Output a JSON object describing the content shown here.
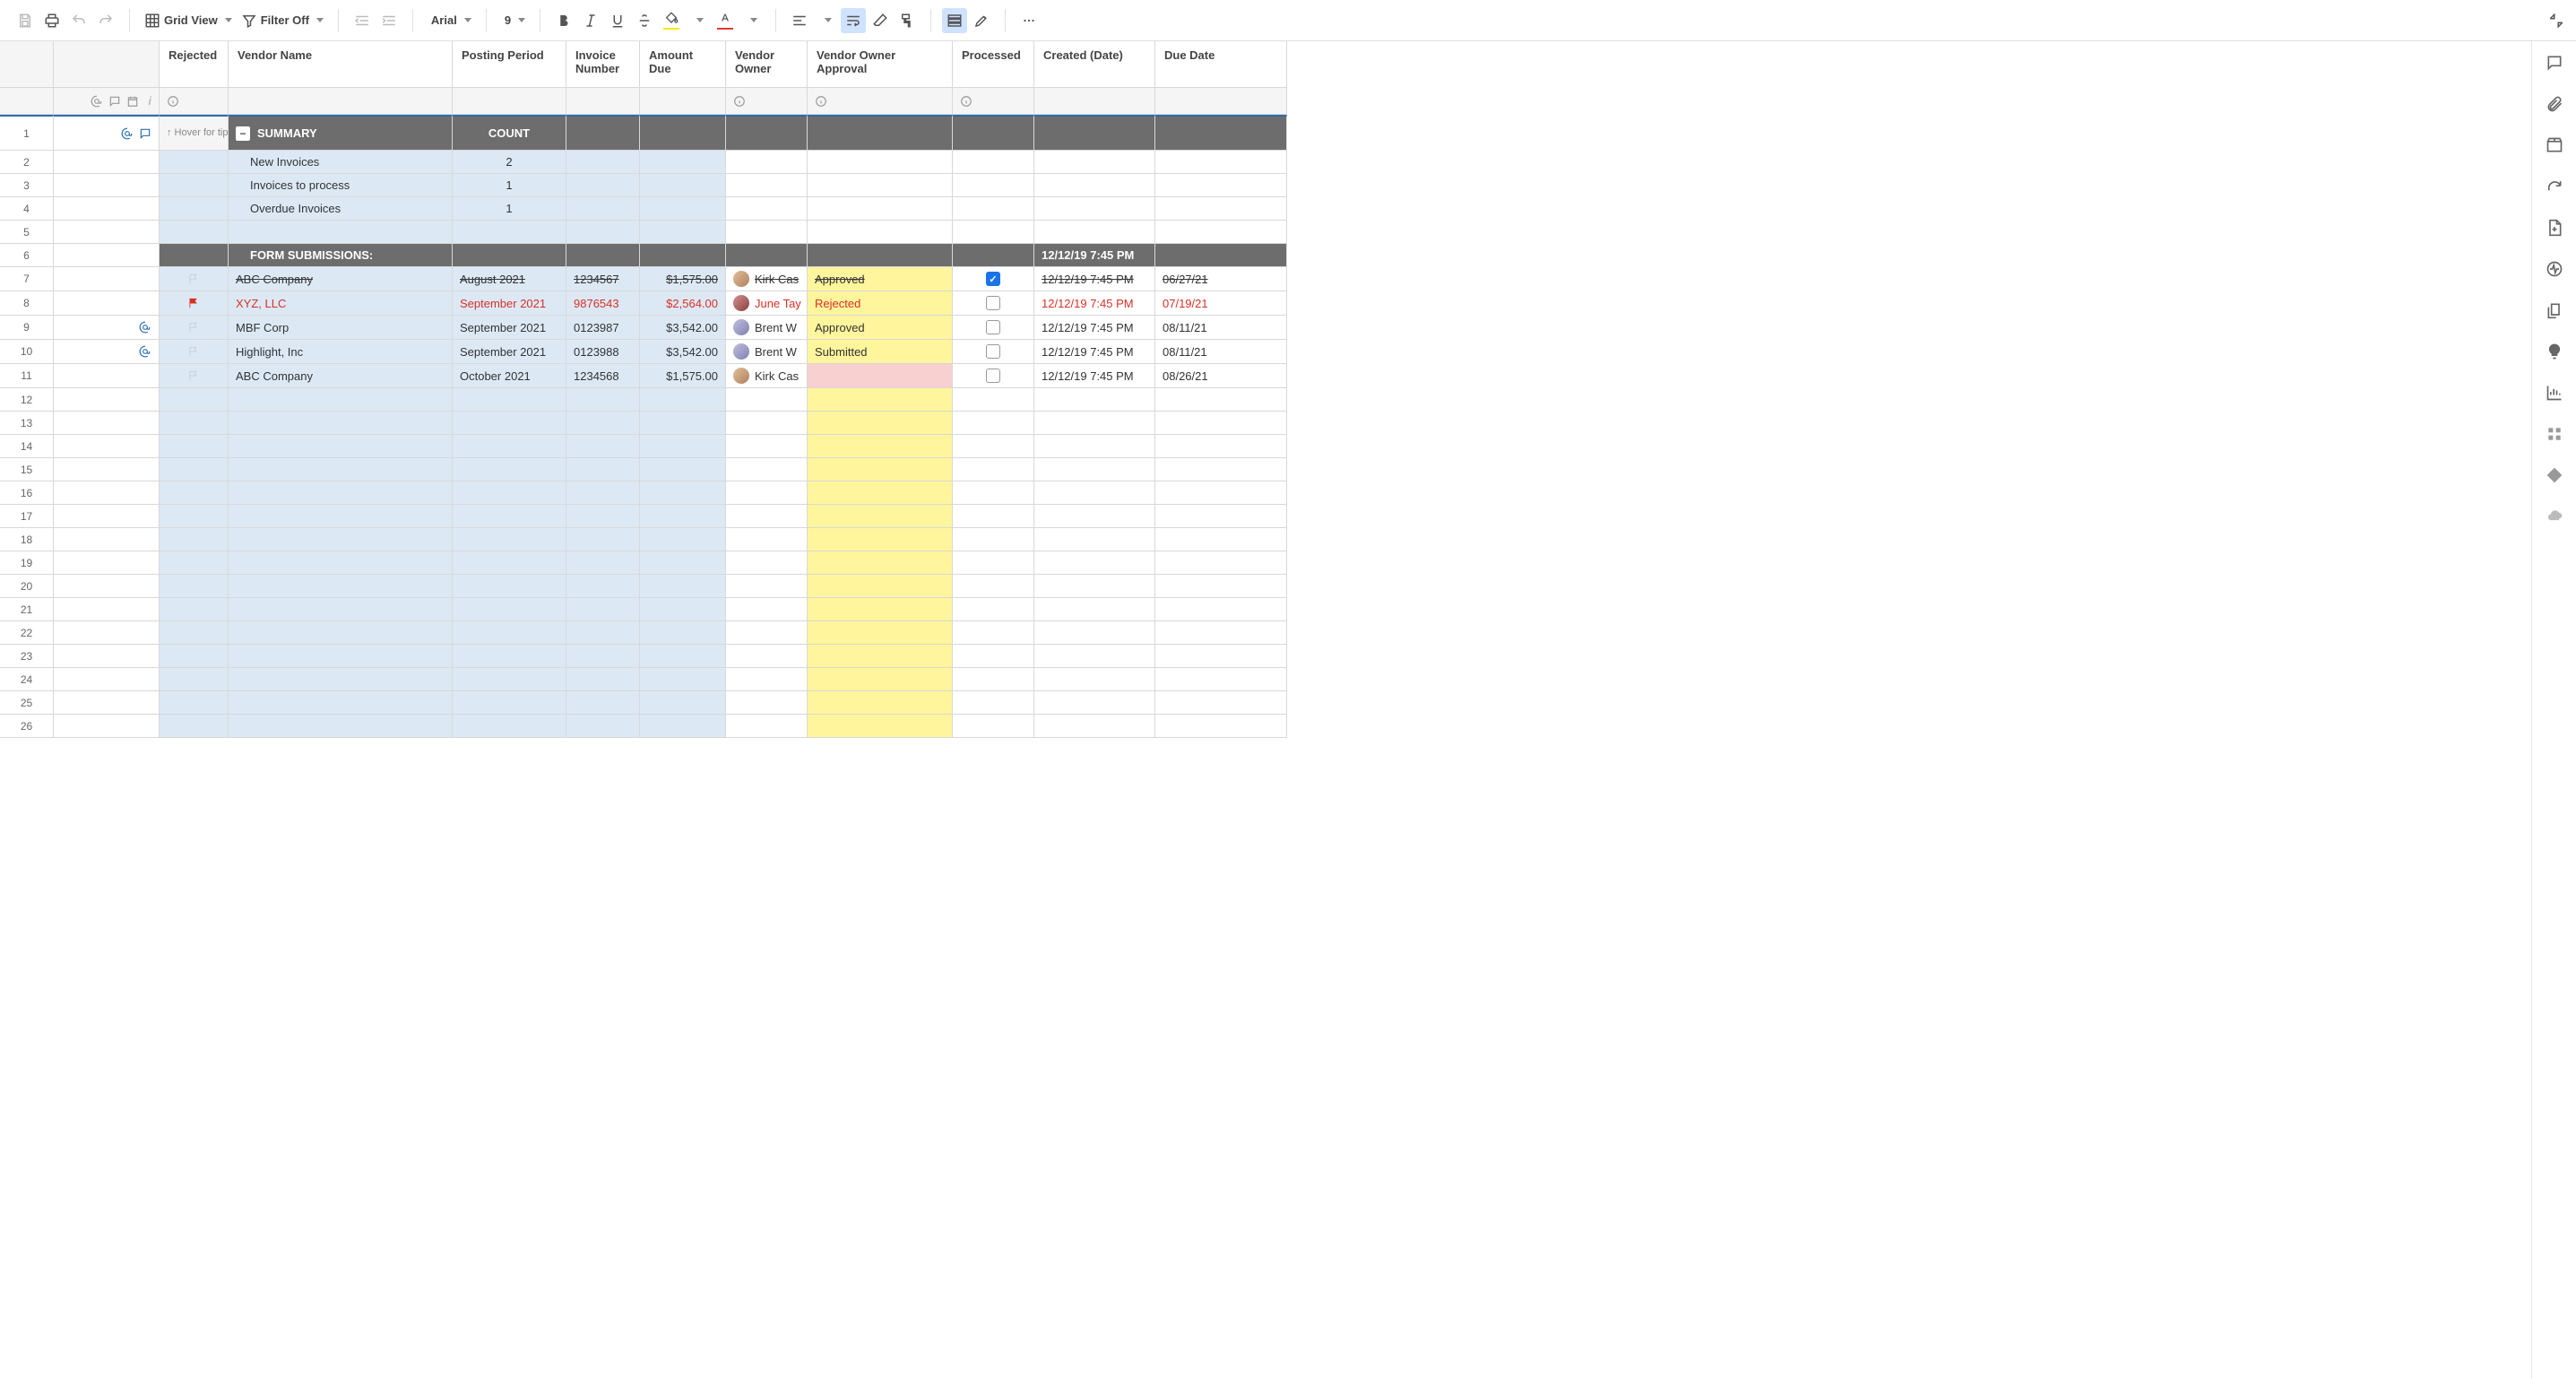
{
  "toolbar": {
    "view_label": "Grid View",
    "filter_label": "Filter Off",
    "font_family": "Arial",
    "font_size": "9"
  },
  "columns": {
    "rejected": "Rejected",
    "vendor_name": "Vendor Name",
    "posting_period": "Posting Period",
    "invoice_number": "Invoice Number",
    "amount_due": "Amount Due",
    "vendor_owner": "Vendor Owner",
    "vendor_owner_approval": "Vendor Owner Approval",
    "processed": "Processed",
    "created_date": "Created (Date)",
    "due_date": "Due Date"
  },
  "hover_tips": "↑ Hover for tips",
  "summary": {
    "header_label": "SUMMARY",
    "count_label": "COUNT",
    "rows": [
      {
        "label": "New Invoices",
        "count": "2"
      },
      {
        "label": "Invoices to process",
        "count": "1"
      },
      {
        "label": "Overdue Invoices",
        "count": "1"
      }
    ]
  },
  "form_submissions_label": "FORM SUBMISSIONS:",
  "form_submissions_created": "12/12/19 7:45 PM",
  "rows": [
    {
      "vendor": "ABC Company",
      "period": "August 2021",
      "invoice": "1234567",
      "amount": "$1,575.00",
      "owner": "Kirk Cas",
      "approval": "Approved",
      "processed": true,
      "created": "12/12/19 7:45 PM",
      "due": "06/27/21",
      "style": "strike",
      "flag": "outline"
    },
    {
      "vendor": "XYZ, LLC",
      "period": "September 2021",
      "invoice": "9876543",
      "amount": "$2,564.00",
      "owner": "June Tay",
      "approval": "Rejected",
      "processed": false,
      "created": "12/12/19 7:45 PM",
      "due": "07/19/21",
      "style": "red",
      "flag": "red"
    },
    {
      "vendor": "MBF Corp",
      "period": "September 2021",
      "invoice": "0123987",
      "amount": "$3,542.00",
      "owner": "Brent W",
      "approval": "Approved",
      "processed": false,
      "created": "12/12/19 7:45 PM",
      "due": "08/11/21",
      "style": "normal",
      "flag": "outline",
      "attach": true
    },
    {
      "vendor": "Highlight, Inc",
      "period": "September 2021",
      "invoice": "0123988",
      "amount": "$3,542.00",
      "owner": "Brent W",
      "approval": "Submitted",
      "processed": false,
      "created": "12/12/19 7:45 PM",
      "due": "08/11/21",
      "style": "normal",
      "flag": "outline",
      "attach": true
    },
    {
      "vendor": "ABC Company",
      "period": "October 2021",
      "invoice": "1234568",
      "amount": "$1,575.00",
      "owner": "Kirk Cas",
      "approval": "",
      "processed": false,
      "created": "12/12/19 7:45 PM",
      "due": "08/26/21",
      "style": "normal",
      "flag": "outline",
      "pink": true
    }
  ],
  "blank_rows_start": 12,
  "blank_rows_end": 26
}
